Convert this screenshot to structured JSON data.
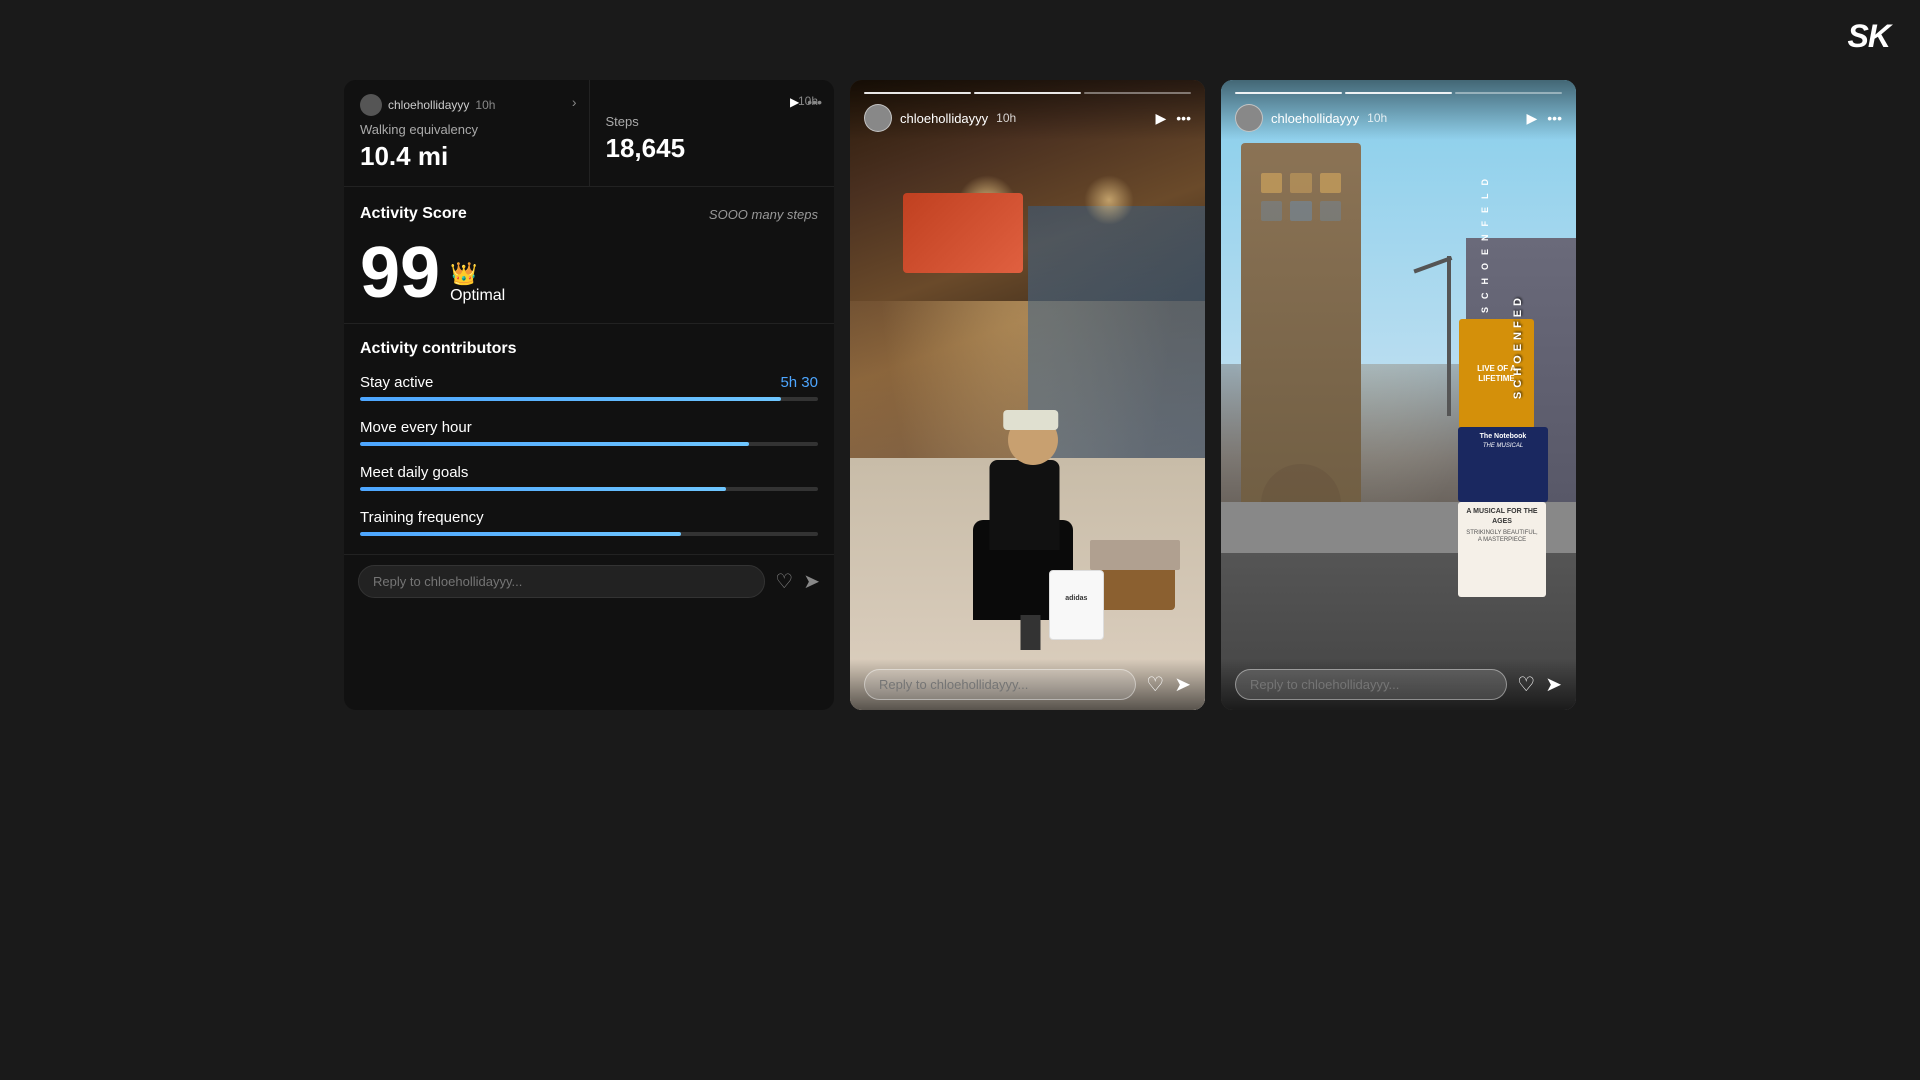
{
  "logo": {
    "text": "SK"
  },
  "health_panel": {
    "user": {
      "name": "chloehollidayyy",
      "time_ago": "10h"
    },
    "walking": {
      "label": "Walking equivalency",
      "value": "10.4 mi"
    },
    "steps": {
      "label": "Steps",
      "value": "18,645"
    },
    "activity_score": {
      "title": "Activity Score",
      "subtitle": "SOOO many steps",
      "score": "99",
      "status": "Optimal"
    },
    "contributors": {
      "title": "Activity contributors",
      "items": [
        {
          "name": "Stay active",
          "value": "5h 30",
          "progress": 92
        },
        {
          "name": "Move every hour",
          "value": "",
          "progress": 85
        },
        {
          "name": "Meet daily goals",
          "value": "",
          "progress": 80
        },
        {
          "name": "Training frequency",
          "value": "",
          "progress": 70
        }
      ]
    },
    "reply": {
      "placeholder": "Reply to chloehollidayyy..."
    }
  },
  "story1": {
    "username": "chloehollidayyy",
    "time_ago": "10h",
    "reply_placeholder": "Reply to chloehollidayyy...",
    "scene": "store_interior"
  },
  "story2": {
    "username": "chloehollidayyy",
    "time_ago": "10h",
    "reply_placeholder": "Reply to chloehollidayyy...",
    "scene": "city_street",
    "poster": {
      "title": "The Notebook",
      "subtitle": "A MUSICAL FOR THE AGES",
      "tagline": "STRIKINGLY BEAUTIFUL, A MASTERPIECE"
    }
  }
}
